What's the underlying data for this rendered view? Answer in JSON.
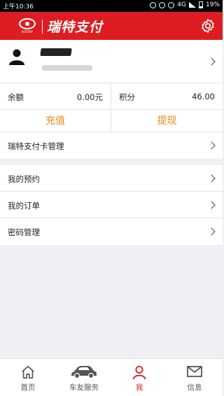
{
  "status_bar": {
    "time": "上午10:36",
    "network": "4G",
    "battery": "19%",
    "icons": [
      "alarm-icon",
      "clock-icon",
      "mute-icon",
      "signal-icon",
      "battery-icon"
    ]
  },
  "app": {
    "logo_text": "瑞特支付",
    "logo_small_text": "RITEPAY",
    "brand_color": "#dd1d21",
    "accent_color": "#e98a15"
  },
  "balance": {
    "balance_label": "余额",
    "balance_value": "0.00元",
    "points_label": "积分",
    "points_value": "46.00"
  },
  "actions": {
    "recharge": "充值",
    "withdraw": "提现"
  },
  "menu": {
    "card_manage": "瑞特支付卡管理",
    "reservations": "我的预约",
    "orders": "我的订单",
    "password": "密码管理"
  },
  "tabs": [
    {
      "label": "首页",
      "icon": "home-icon"
    },
    {
      "label": "车友服务",
      "icon": "car-icon"
    },
    {
      "label": "我",
      "icon": "person-icon",
      "active": true
    },
    {
      "label": "信息",
      "icon": "mail-icon"
    }
  ]
}
